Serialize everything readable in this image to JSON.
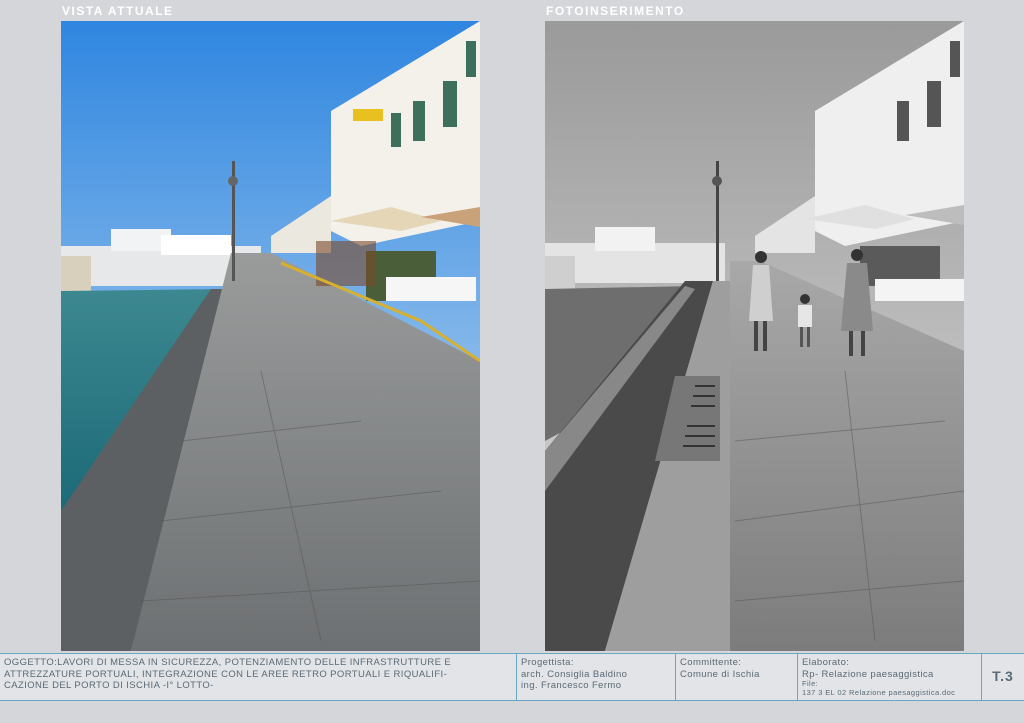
{
  "panels": {
    "left_label": "VISTA ATTUALE",
    "right_label": "FOTOINSERIMENTO"
  },
  "titleblock": {
    "oggetto": [
      "OGGETTO:LAVORI DI MESSA IN SICUREZZA, POTENZIAMENTO DELLE INFRASTRUTTURE E",
      "ATTREZZATURE PORTUALI, INTEGRAZIONE CON LE AREE RETRO PORTUALI E RIQUALIFI-",
      "CAZIONE DEL PORTO DI ISCHIA -I° LOTTO-"
    ],
    "progettista_label": "Progettista:",
    "progettista_1": "arch. Consiglia Baldino",
    "progettista_2": "ing. Francesco Fermo",
    "committente_label": "Committente:",
    "committente": "Comune di Ischia",
    "elaborato_label": "Elaborato:",
    "elaborato": "Rp- Relazione paesaggistica",
    "file_label": "File:",
    "file": "137 3 EL 02 Relazione paesaggistica.doc",
    "code": "T.3"
  },
  "colors": {
    "background": "#d4d6da",
    "border": "#6aa7c4",
    "text": "#5b6a76"
  }
}
